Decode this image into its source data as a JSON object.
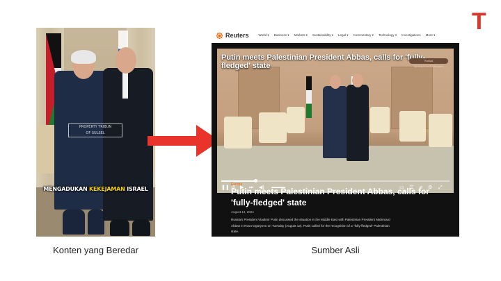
{
  "brand": {
    "logo_text": "T",
    "accent": "#d63a2f"
  },
  "left": {
    "caption_part1": "MENGADUKAN",
    "caption_highlight": "KEKEJAMAN",
    "caption_part2": "ISRAEL",
    "watermark_line1": "PROPERTY",
    "watermark_line2": "OF",
    "watermark_line3": "TRIBUN",
    "watermark_line4": "SULSEL",
    "label": "Konten yang Beredar"
  },
  "right": {
    "label": "Sumber Asli",
    "logo": "Reuters",
    "nav": [
      "World ▾",
      "Business ▾",
      "Markets ▾",
      "Sustainability ▾",
      "Legal ▾",
      "Commentary ▾",
      "Technology ▾",
      "Investigations",
      "More ▾"
    ],
    "video_title": "Putin meets Palestinian President Abbas, calls for 'fully-fledged' state",
    "video_badge": "Russia Sputnik/Kremlin/Reuters",
    "progress": 0.15,
    "section": "Europe",
    "headline": "Putin meets Palestinian President Abbas, calls for 'fully-fledged' state",
    "date": "August 13, 2024",
    "body": "Russia's President Vladimir Putin discussed the situation in the Middle East with Palestinian President Mahmoud Abbas in Novo-Ogaryovo on Tuesday (August 13). Putin called for the recognition of a \"fully-fledged\" Palestinian state."
  },
  "icons": {
    "play": "play-icon",
    "arrow": "right-arrow-icon"
  },
  "colors": {
    "arrow": "#e8342a",
    "reuters_orange": "#fa6400",
    "page_bg": "#111111"
  }
}
